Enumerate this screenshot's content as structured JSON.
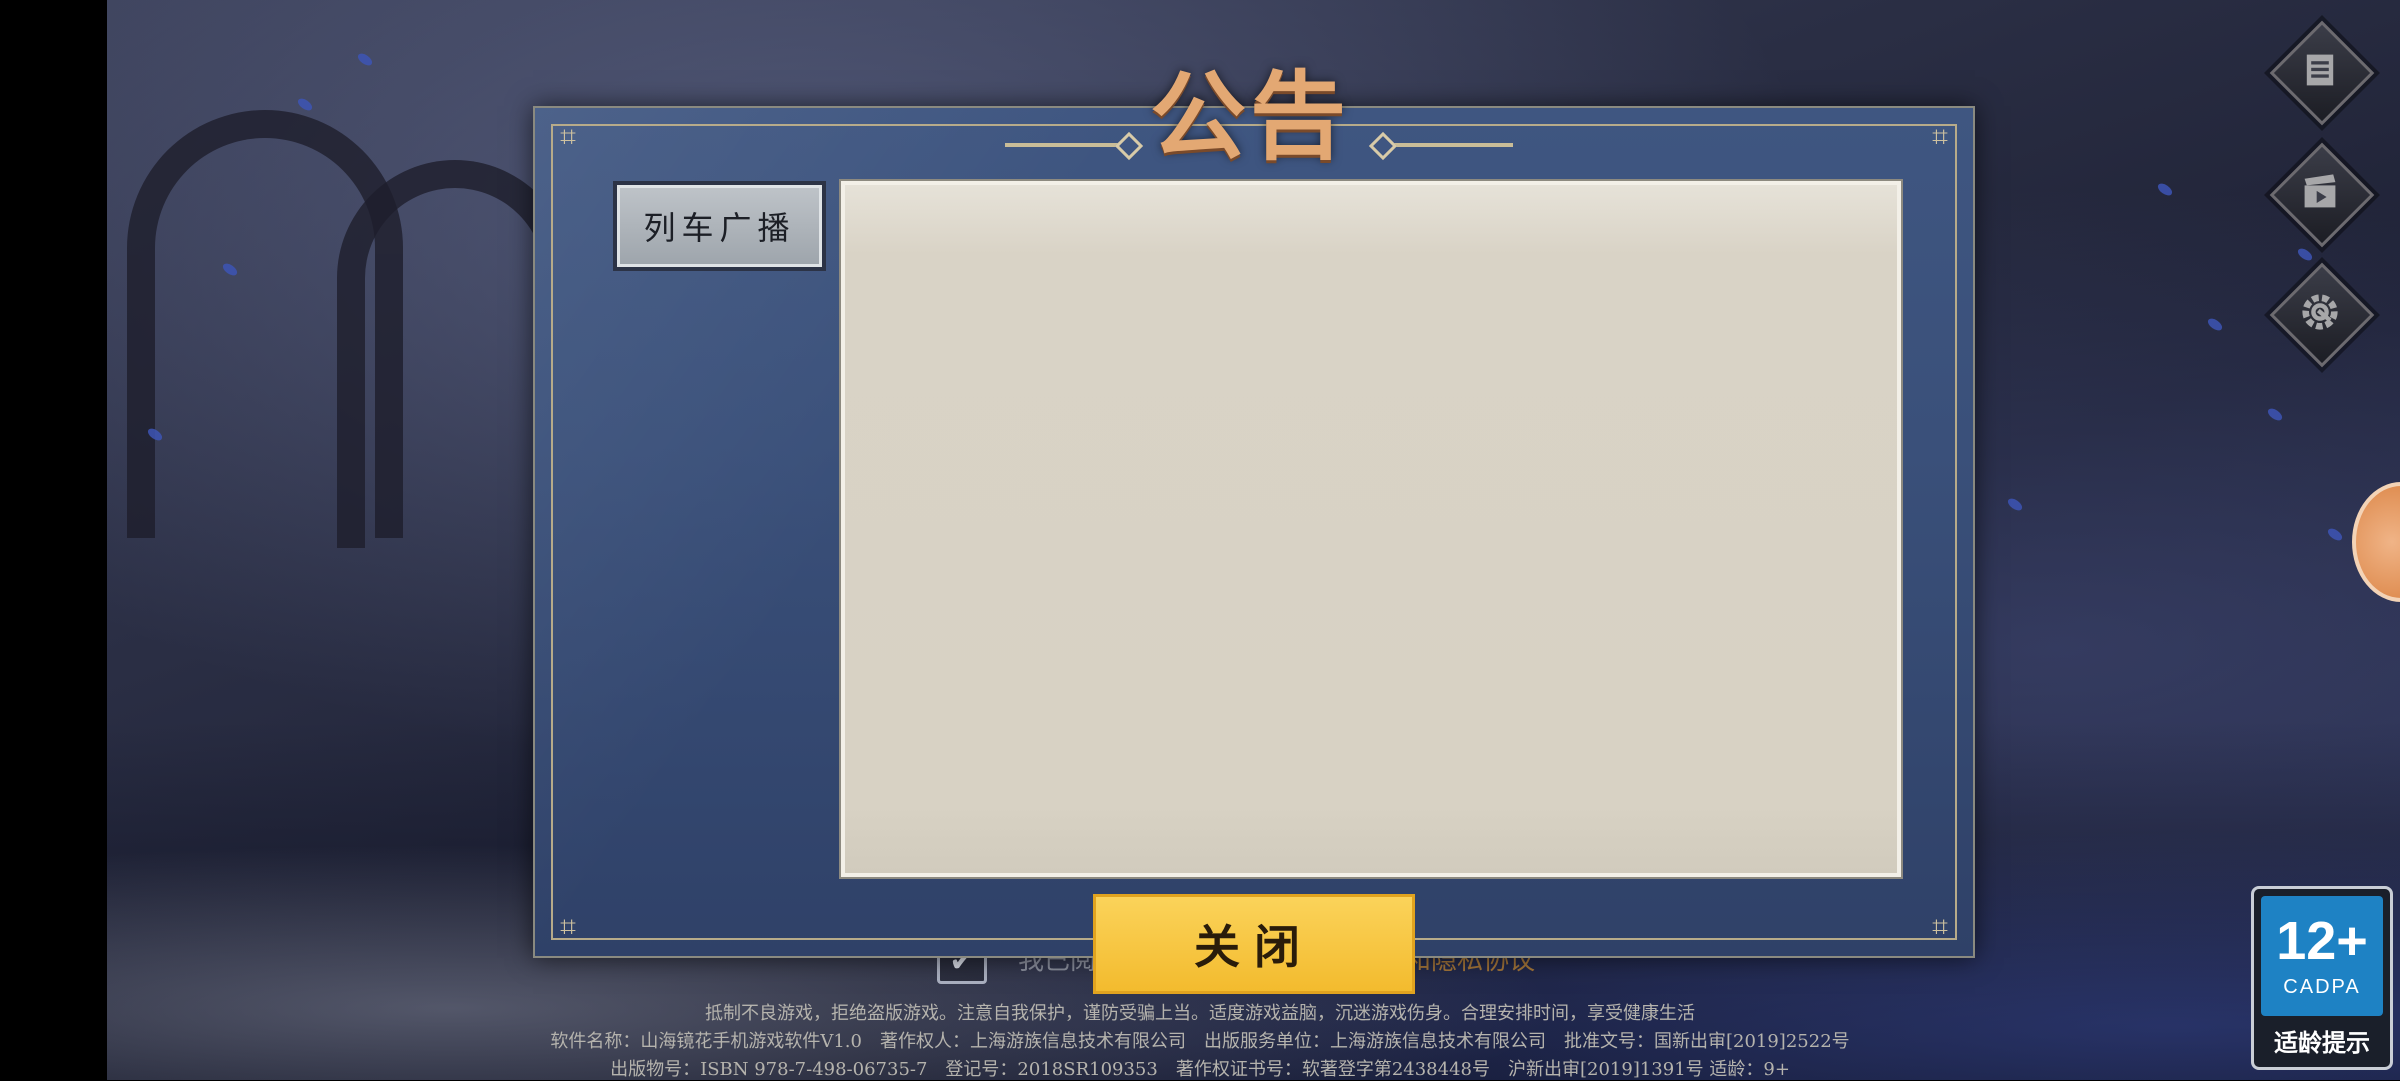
{
  "dialog": {
    "title": "公告",
    "tabs": [
      {
        "label": "列车广播"
      }
    ],
    "close_label": "关闭"
  },
  "agreement": {
    "checked": true,
    "check_glyph": "✔",
    "text_prefix": "我已阅",
    "link_text": "和隐私协议"
  },
  "footer": {
    "line1": "抵制不良游戏，拒绝盗版游戏。注意自我保护，谨防受骗上当。适度游戏益脑，沉迷游戏伤身。合理安排时间，享受健康生活",
    "line2": "软件名称：山海镜花手机游戏软件V1.0　著作权人：上海游族信息技术有限公司　出版服务单位：上海游族信息技术有限公司　批准文号：国新出审[2019]2522号",
    "line3": "出版物号：ISBN 978-7-498-06735-7　登记号：2018SR109353　著作权证书号：软著登字第2438448号　沪新出审[2019]1391号 适龄：9+"
  },
  "age_rating": {
    "number": "12+",
    "org": "CADPA",
    "tip": "适龄提示"
  },
  "side_buttons": [
    {
      "icon": "notice-list-icon"
    },
    {
      "icon": "video-clapper-icon"
    },
    {
      "icon": "settings-gear-icon"
    }
  ],
  "colors": {
    "dialog_bg": "#3a507a",
    "title_gold": "#e3a873",
    "close_button": "#f3bb2e",
    "panel_paper": "#d9d3c6",
    "age_badge_blue": "#1e82c4"
  }
}
